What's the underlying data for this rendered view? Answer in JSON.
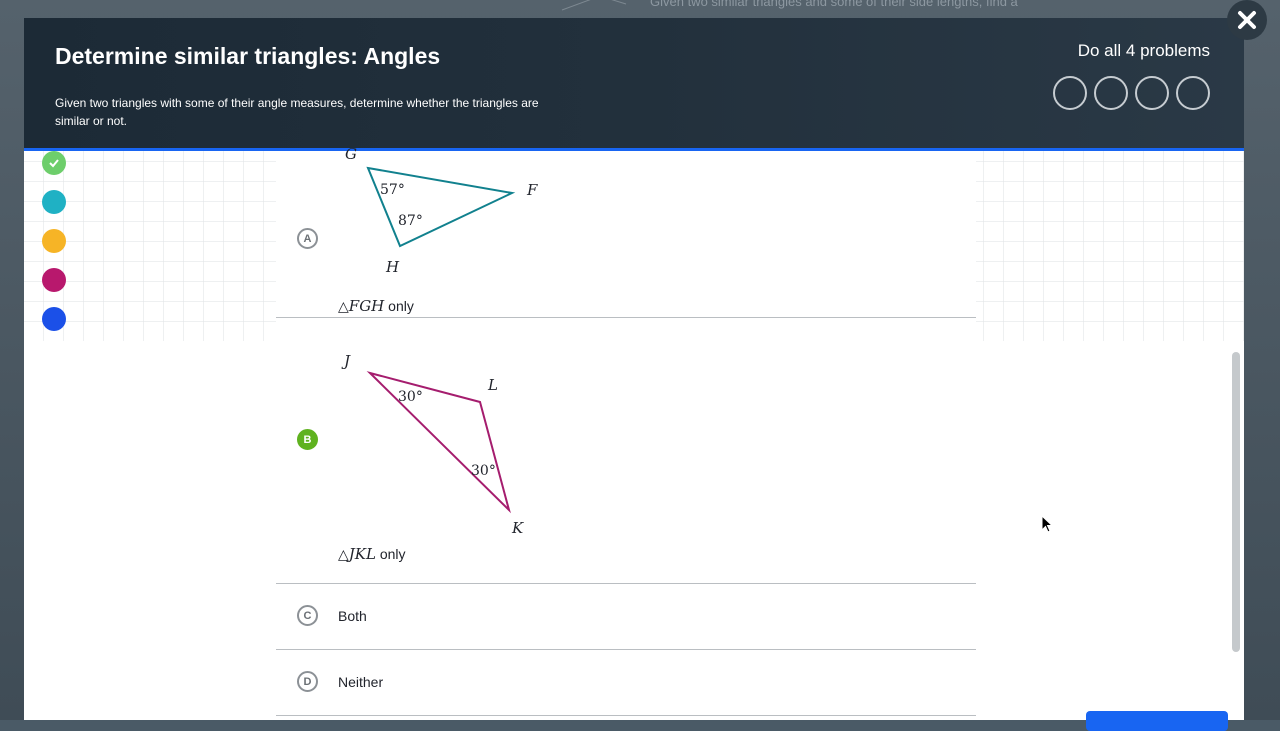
{
  "background": {
    "partial_text": "Given two similar triangles and some of their side lengths, find a"
  },
  "header": {
    "title": "Determine similar triangles: Angles",
    "subtitle": "Given two triangles with some of their angle measures, determine whether the triangles are similar or not.",
    "problems_label": "Do all 4 problems",
    "problem_circles": 4
  },
  "progress_dots": [
    {
      "color": "#6dce6b",
      "status": "complete"
    },
    {
      "color": "#1fb1c4",
      "status": ""
    },
    {
      "color": "#f6b426",
      "status": ""
    },
    {
      "color": "#b8186d",
      "status": ""
    },
    {
      "color": "#1b50e8",
      "status": ""
    }
  ],
  "choices": [
    {
      "letter": "A",
      "selected": false,
      "triangle": "FGH",
      "label_prefix": "△",
      "label_vars": "FGH",
      "label_suffix": " only",
      "vertices": {
        "top": "G",
        "right": "F",
        "bottom": "H"
      },
      "angles": [
        "57°",
        "87°"
      ],
      "color": "#11818e"
    },
    {
      "letter": "B",
      "selected": true,
      "triangle": "JKL",
      "label_prefix": "△",
      "label_vars": "JKL",
      "label_suffix": " only",
      "vertices": {
        "top": "J",
        "right": "L",
        "bottom": "K"
      },
      "angles": [
        "30°",
        "30°"
      ],
      "color": "#a51d6e"
    },
    {
      "letter": "C",
      "selected": false,
      "text": "Both"
    },
    {
      "letter": "D",
      "selected": false,
      "text": "Neither"
    }
  ],
  "icons": {
    "close": "close-x-icon",
    "check": "checkmark-icon",
    "cursor": "mouse-pointer-icon"
  }
}
